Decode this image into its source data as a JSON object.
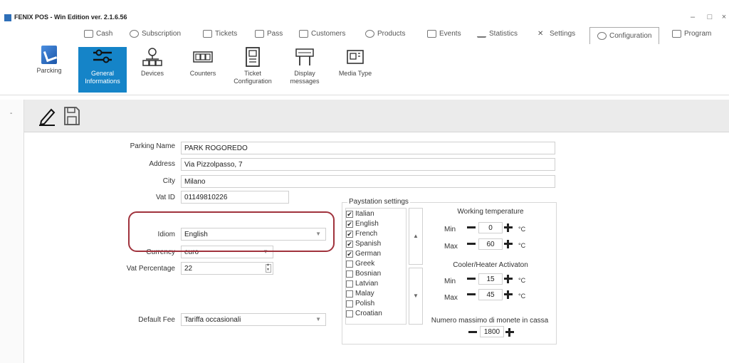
{
  "window": {
    "title": "FENIX POS - Win Edition ver. 2.1.6.56",
    "minimize": "–",
    "maximize": "□",
    "close": "×"
  },
  "nav": {
    "items": [
      {
        "label": "Cash",
        "icon": "cash-icon"
      },
      {
        "label": "Subscription",
        "icon": "subscription-icon"
      },
      {
        "label": "Tickets",
        "icon": "tickets-icon"
      },
      {
        "label": "Pass",
        "icon": "pass-icon"
      },
      {
        "label": "Customers",
        "icon": "customers-icon"
      },
      {
        "label": "Products",
        "icon": "products-icon"
      },
      {
        "label": "Events",
        "icon": "events-icon"
      },
      {
        "label": "Statistics",
        "icon": "statistics-icon"
      },
      {
        "label": "Settings",
        "icon": "settings-icon"
      },
      {
        "label": "Configuration",
        "icon": "configuration-icon"
      },
      {
        "label": "Program",
        "icon": "program-icon"
      }
    ],
    "active": "Configuration"
  },
  "side_app": {
    "label": "Parcking"
  },
  "ribbon": {
    "general_line1": "General",
    "general_line2": "Informations",
    "devices": "Devices",
    "counters": "Counters",
    "ticket_line1": "Ticket",
    "ticket_line2": "Configuration",
    "display_line1": "Display",
    "display_line2": "messages",
    "media": "Media Type",
    "accent": "#1584c8"
  },
  "form": {
    "parking_name_label": "Parking Name",
    "parking_name": "PARK ROGOREDO",
    "address_label": "Address",
    "address": "Via Pizzolpasso, 7",
    "city_label": "City",
    "city": "Milano",
    "vat_id_label": "Vat ID",
    "vat_id": "01149810226",
    "idiom_label": "Idiom",
    "idiom": "English",
    "currency_label": "Currency",
    "currency": "euro",
    "vat_percentage_label": "Vat Percentage",
    "vat_percentage": "22",
    "default_fee_label": "Default Fee",
    "default_fee": "Tariffa occasionali"
  },
  "paystation": {
    "title": "Paystation settings",
    "languages": [
      {
        "name": "Italian",
        "checked": "✔"
      },
      {
        "name": "English",
        "checked": "✔"
      },
      {
        "name": "French",
        "checked": "✔"
      },
      {
        "name": "Spanish",
        "checked": "✔"
      },
      {
        "name": "German",
        "checked": "✔"
      },
      {
        "name": "Greek",
        "checked": ""
      },
      {
        "name": "Bosnian",
        "checked": ""
      },
      {
        "name": "Latvian",
        "checked": ""
      },
      {
        "name": "Malay",
        "checked": ""
      },
      {
        "name": "Polish",
        "checked": ""
      },
      {
        "name": "Croatian",
        "checked": ""
      }
    ],
    "scroll_up": "▲",
    "scroll_down": "▼",
    "working_temp_title": "Working temperature",
    "min_label": "Min",
    "max_label": "Max",
    "working_min": "0",
    "working_max": "60",
    "unit": "°C",
    "cooler_title": "Cooler/Heater Activaton",
    "cooler_min": "15",
    "cooler_max": "45",
    "coins_title": "Numero massimo di monete in cassa",
    "coins": "1800"
  },
  "colors": {
    "highlight": "#a0323c",
    "active_tab": "#1584c8"
  }
}
